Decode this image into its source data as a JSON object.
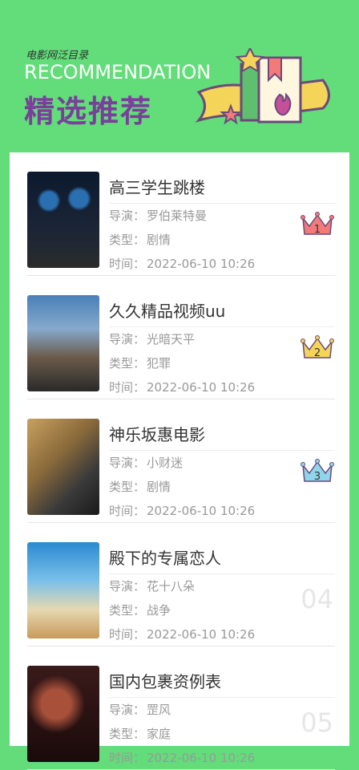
{
  "header": {
    "sub_title": "电影网泛目录",
    "en_title": "RECOMMENDATION",
    "cn_title": "精选推荐"
  },
  "labels": {
    "director": "导演：",
    "genre": "类型：",
    "time": "时间："
  },
  "items": [
    {
      "title": "高三学生跳楼",
      "director": "罗伯莱特曼",
      "genre": "剧情",
      "time": "2022-06-10 10:26",
      "rank": "1",
      "badge_color": "#f27a7a"
    },
    {
      "title": "久久精品视频uu",
      "director": "光暗天平",
      "genre": "犯罪",
      "time": "2022-06-10 10:26",
      "rank": "2",
      "badge_color": "#f5d45a"
    },
    {
      "title": "神乐坂惠电影",
      "director": "小财迷",
      "genre": "剧情",
      "time": "2022-06-10 10:26",
      "rank": "3",
      "badge_color": "#8fd6ea"
    },
    {
      "title": "殿下的专属恋人",
      "director": "花十八朵",
      "genre": "战争",
      "time": "2022-06-10 10:26",
      "rank": "04"
    },
    {
      "title": "国内包裹资例表",
      "director": "罡风",
      "genre": "家庭",
      "time": "2022-06-10 10:26",
      "rank": "05"
    }
  ]
}
